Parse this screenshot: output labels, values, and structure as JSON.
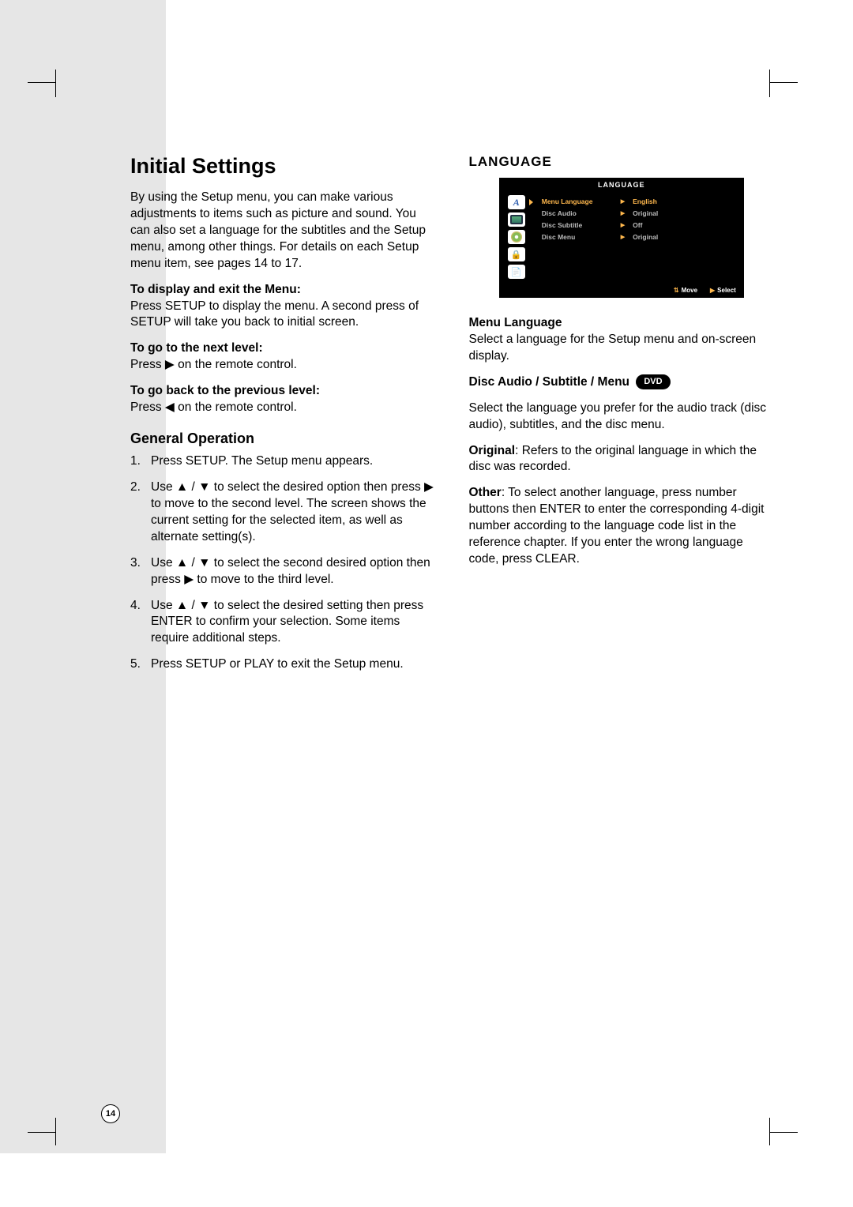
{
  "page_number": "14",
  "left": {
    "title": "Initial Settings",
    "intro": "By using the Setup menu, you can make various adjustments to items such as picture and sound. You can also set a language for the subtitles and the Setup menu, among other things. For details on each Setup menu item, see pages 14 to 17.",
    "display_exit_head": "To display and exit the Menu:",
    "display_exit_body": "Press SETUP to display the menu. A second press of SETUP will take you back to initial screen.",
    "next_level_head": "To go to the next level:",
    "next_level_body": "Press ▶ on the remote control.",
    "prev_level_head": "To go back to the previous level:",
    "prev_level_body": "Press ◀ on the remote control.",
    "general_op_title": "General Operation",
    "steps": {
      "s1": "Press SETUP. The Setup menu appears.",
      "s2": "Use ▲ / ▼ to select the desired option then press ▶ to move to the second level. The screen shows the current setting for the selected item, as well as alternate setting(s).",
      "s3": "Use ▲ / ▼ to select the second desired option then press ▶ to move to the third level.",
      "s4": "Use ▲ / ▼ to select the desired setting then press ENTER to confirm your selection. Some items require additional steps.",
      "s5": "Press SETUP or PLAY to exit the Setup menu."
    },
    "nums": {
      "n1": "1.",
      "n2": "2.",
      "n3": "3.",
      "n4": "4.",
      "n5": "5."
    }
  },
  "right": {
    "section_title": "LANGUAGE",
    "osd": {
      "title": "LANGUAGE",
      "rows": [
        {
          "label": "Menu Language",
          "value": "English",
          "selected": true
        },
        {
          "label": "Disc Audio",
          "value": "Original",
          "selected": false
        },
        {
          "label": "Disc Subtitle",
          "value": "Off",
          "selected": false
        },
        {
          "label": "Disc Menu",
          "value": "Original",
          "selected": false
        }
      ],
      "foot_move": "Move",
      "foot_select": "Select"
    },
    "menu_lang_head": "Menu Language",
    "menu_lang_body": "Select a language for the Setup menu and on-screen display.",
    "dasm_head": "Disc Audio / Subtitle / Menu",
    "dvd_badge": "DVD",
    "dasm_body": "Select the language you prefer for the audio track (disc audio), subtitles, and the disc menu.",
    "original_bold": "Original",
    "original_rest": ": Refers to the original language in which the disc was recorded.",
    "other_bold": "Other",
    "other_rest": ": To select another language, press number buttons then ENTER to enter the corresponding 4-digit number according to the language code list in the reference chapter. If you enter the wrong language code, press CLEAR."
  }
}
